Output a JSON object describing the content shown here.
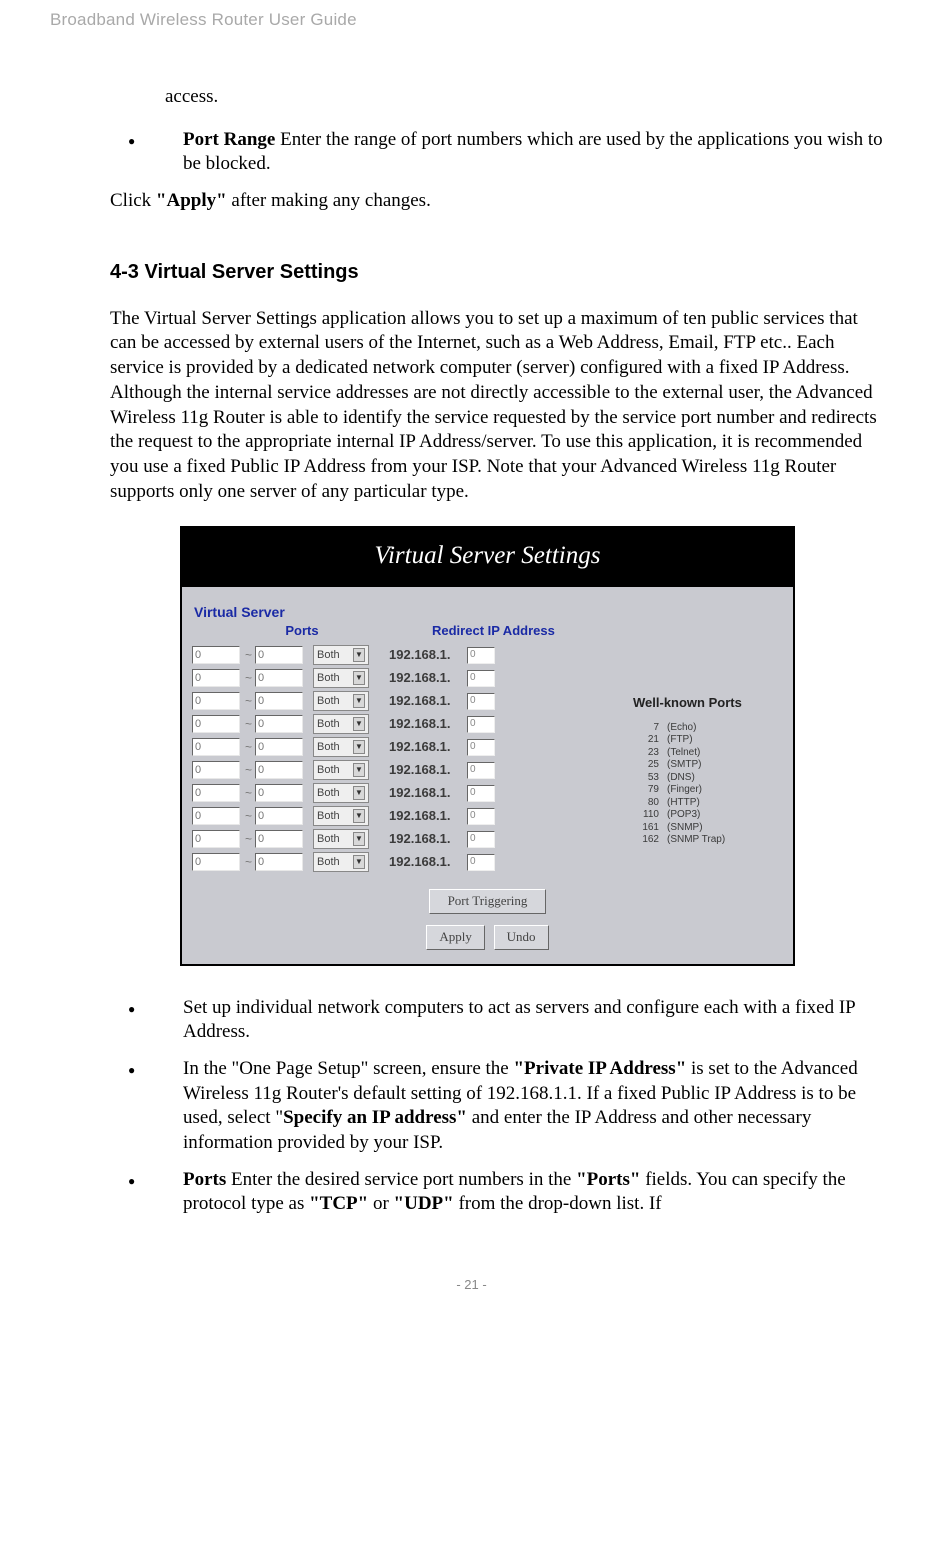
{
  "header": {
    "title": "Broadband Wireless Router User Guide"
  },
  "intro": {
    "access_cont": "access.",
    "port_range_label": "Port Range",
    "port_range_text": " Enter the range of port numbers which are used by the applications you wish to be blocked.",
    "click_prefix": "Click ",
    "apply_quoted": "\"Apply\"",
    "click_suffix": " after making any changes."
  },
  "section": {
    "heading": "4-3 Virtual Server Settings",
    "description": "The Virtual Server Settings application allows you to set up a maximum of ten public services that can be accessed by external users of the Internet, such as a Web Address, Email, FTP etc.. Each service is provided by a dedicated network computer (server) configured with a fixed IP Address. Although the internal service addresses are not directly accessible to the external user, the Advanced Wireless 11g Router is able to identify the service requested by the service port number and redirects the request to the appropriate internal IP Address/server. To use this application, it is recommended you use a fixed Public IP Address from your ISP. Note that your Advanced Wireless 11g Router supports only one server of any particular type."
  },
  "figure": {
    "title": "Virtual Server Settings",
    "vs_label": "Virtual Server",
    "col_ports": "Ports",
    "col_redirect": "Redirect IP Address",
    "row": {
      "port_from": "0",
      "port_to": "0",
      "proto": "Both",
      "ip_prefix": "192.168.1.",
      "ip_last": "0"
    },
    "row_count": 10,
    "wellknown_title": "Well-known Ports",
    "wellknown": [
      {
        "n": "7",
        "t": "(Echo)"
      },
      {
        "n": "21",
        "t": "(FTP)"
      },
      {
        "n": "23",
        "t": "(Telnet)"
      },
      {
        "n": "25",
        "t": "(SMTP)"
      },
      {
        "n": "53",
        "t": "(DNS)"
      },
      {
        "n": "79",
        "t": "(Finger)"
      },
      {
        "n": "80",
        "t": "(HTTP)"
      },
      {
        "n": "110",
        "t": "(POP3)"
      },
      {
        "n": "161",
        "t": "(SNMP)"
      },
      {
        "n": "162",
        "t": "(SNMP Trap)"
      }
    ],
    "btn_port_trigger": "Port Triggering",
    "btn_apply": "Apply",
    "btn_undo": "Undo"
  },
  "bullets": {
    "b1": "Set up individual network computers to act as servers and configure each with a fixed IP Address.",
    "b2_pre": "In the \"One Page Setup\" screen, ensure the ",
    "b2_private_ip": "\"Private IP Address\"",
    "b2_mid": " is set to the Advanced Wireless 11g Router's default setting of 192.168.1.1. If a fixed Public IP Address is to be used, select \"",
    "b2_specify": "Specify an IP address\"",
    "b2_post": " and enter the IP Address and other necessary information provided by your ISP.",
    "b3_ports": "Ports",
    "b3_mid1": " Enter the desired service port numbers in the ",
    "b3_ports_q": "\"Ports\"",
    "b3_mid2": " fields. You can specify the protocol type as ",
    "b3_tcp": "\"TCP\"",
    "b3_or": " or ",
    "b3_udp": "\"UDP\"",
    "b3_end": " from the drop-down list. If"
  },
  "footer": {
    "page": "- 21 -"
  }
}
